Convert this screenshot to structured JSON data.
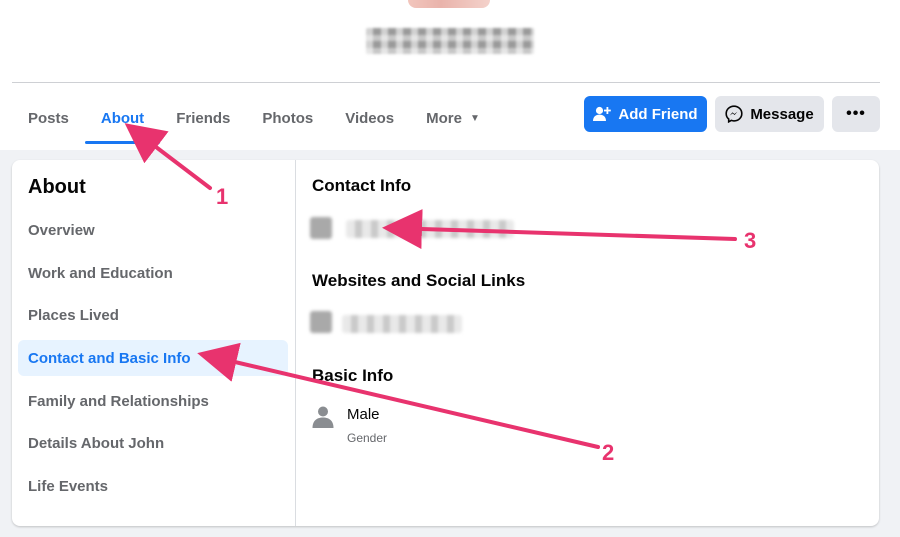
{
  "profile": {
    "name": "",
    "accent": "#1877f2"
  },
  "nav": {
    "tabs": [
      {
        "label": "Posts"
      },
      {
        "label": "About"
      },
      {
        "label": "Friends"
      },
      {
        "label": "Photos"
      },
      {
        "label": "Videos"
      },
      {
        "label": "More"
      }
    ],
    "active_tab": "About"
  },
  "actions": {
    "add_friend": "Add Friend",
    "message": "Message",
    "more": "•••"
  },
  "about": {
    "title": "About",
    "sidebar": [
      {
        "label": "Overview"
      },
      {
        "label": "Work and Education"
      },
      {
        "label": "Places Lived"
      },
      {
        "label": "Contact and Basic Info"
      },
      {
        "label": "Family and Relationships"
      },
      {
        "label": "Details About John"
      },
      {
        "label": "Life Events"
      }
    ],
    "active_item": "Contact and Basic Info",
    "sections": {
      "contact_title": "Contact Info",
      "websites_title": "Websites and Social Links",
      "basic_title": "Basic Info",
      "gender_value": "Male",
      "gender_label": "Gender"
    }
  },
  "annotations": {
    "color": "#e8336e",
    "markers": [
      "1",
      "2",
      "3"
    ]
  }
}
